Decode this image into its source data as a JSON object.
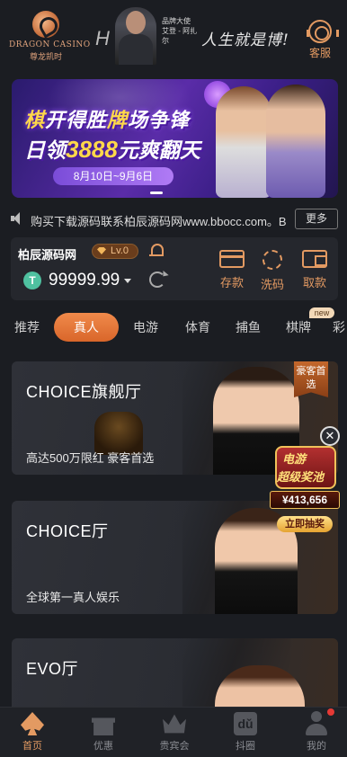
{
  "header": {
    "logo_en": "DRAGON CASINO",
    "logo_cn": "尊龙凯时",
    "ambassador_caption": "品牌大使 艾登 - 阿扎尔",
    "ambassador_slogan": "人生就是博!",
    "customer_service_label": "客服"
  },
  "banner": {
    "line1_a": "棋",
    "line1_b": "开得胜",
    "line1_c": "牌",
    "line1_d": "场争锋",
    "line2_a": "日领",
    "line2_b": "3888",
    "line2_c": "元爽翻天",
    "date_range": "8月10日~9月6日"
  },
  "notice": {
    "text": "购买下载源码联系柏辰源码网www.bbocc.com。B",
    "more_label": "更多"
  },
  "wallet": {
    "username": "柏辰源码网",
    "level": "Lv.0",
    "currency_symbol": "T",
    "balance": "99999.99",
    "actions": [
      {
        "label": "存款"
      },
      {
        "label": "洗码"
      },
      {
        "label": "取款"
      }
    ]
  },
  "tabs": [
    {
      "label": "推荐"
    },
    {
      "label": "真人"
    },
    {
      "label": "电游"
    },
    {
      "label": "体育"
    },
    {
      "label": "捕鱼"
    },
    {
      "label": "棋牌"
    },
    {
      "label": "彩"
    }
  ],
  "new_badge": "new",
  "cards": [
    {
      "title": "CHOICE旗舰厅",
      "subtitle": "高达500万限红 豪客首选",
      "tag": "豪客首选"
    },
    {
      "title": "CHOICE厅",
      "subtitle": "全球第一真人娱乐",
      "tag": ""
    },
    {
      "title": "EVO厅",
      "subtitle": "",
      "tag": ""
    }
  ],
  "jackpot": {
    "close": "✕",
    "title1": "电游",
    "title2": "超级奖池",
    "amount": "¥413,656",
    "button": "立即抽奖"
  },
  "bottom_nav": [
    {
      "label": "首页",
      "icon": "spade-icon"
    },
    {
      "label": "优惠",
      "icon": "gift-icon"
    },
    {
      "label": "贵宾会",
      "icon": "crown-icon"
    },
    {
      "label": "抖圈",
      "icon": "douyin-icon",
      "glyph": "dǔ"
    },
    {
      "label": "我的",
      "icon": "person-icon"
    }
  ],
  "colors": {
    "accent": "#e39a62",
    "background": "#1b1d22",
    "active_tab": "#e8783a"
  }
}
